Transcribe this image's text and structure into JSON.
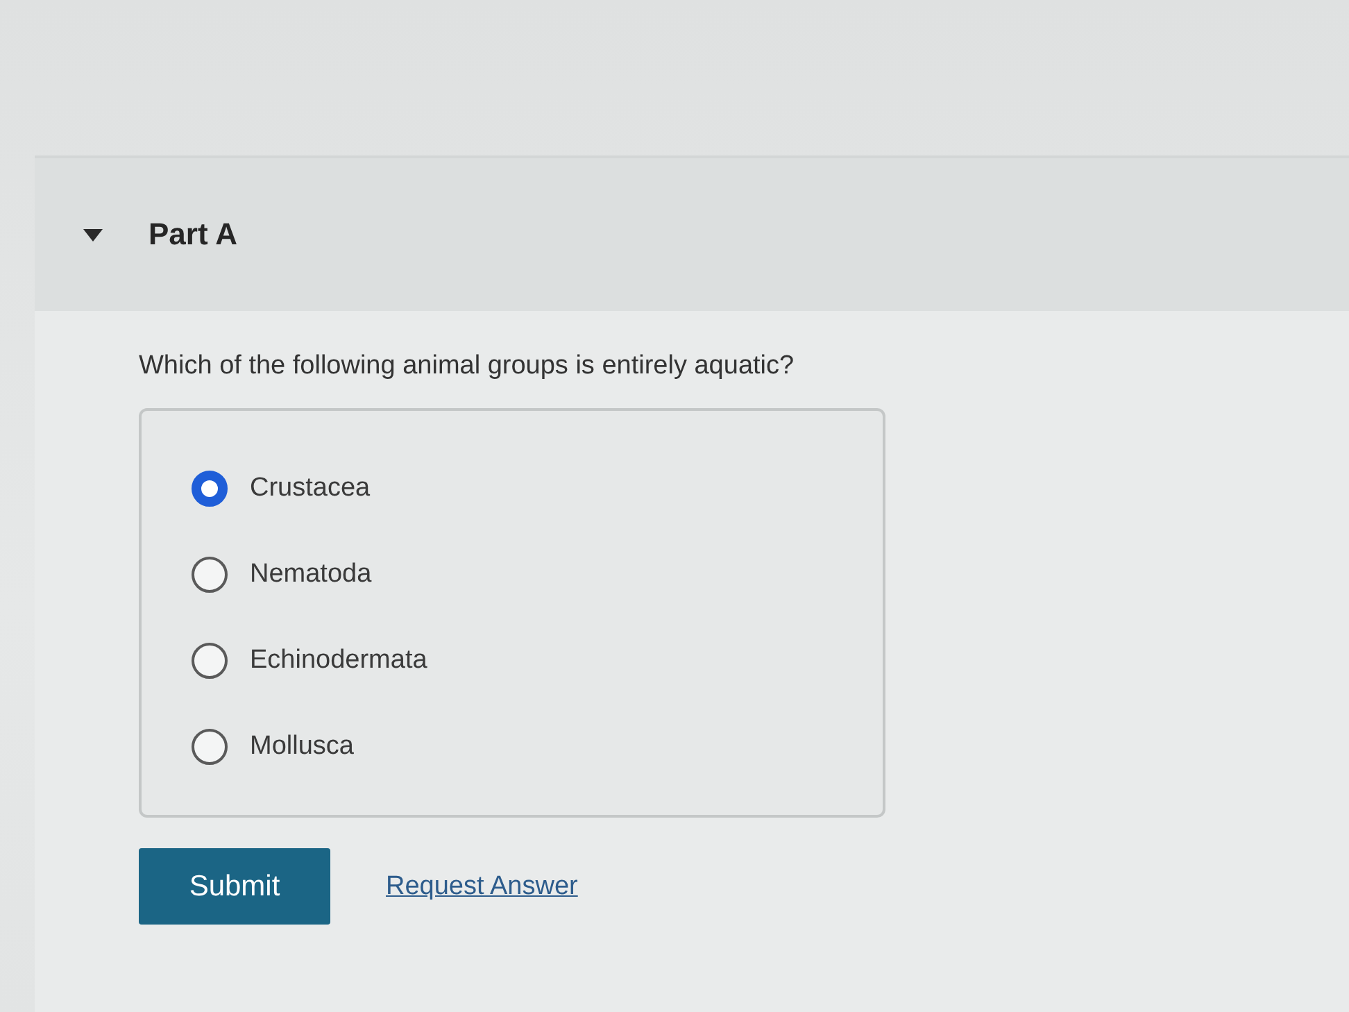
{
  "section": {
    "title": "Part A",
    "expanded": true
  },
  "question": {
    "text": "Which of the following animal groups is entirely aquatic?"
  },
  "options": [
    {
      "label": "Crustacea",
      "selected": true
    },
    {
      "label": "Nematoda",
      "selected": false
    },
    {
      "label": "Echinodermata",
      "selected": false
    },
    {
      "label": "Mollusca",
      "selected": false
    }
  ],
  "actions": {
    "submit": "Submit",
    "request_answer": "Request Answer"
  }
}
